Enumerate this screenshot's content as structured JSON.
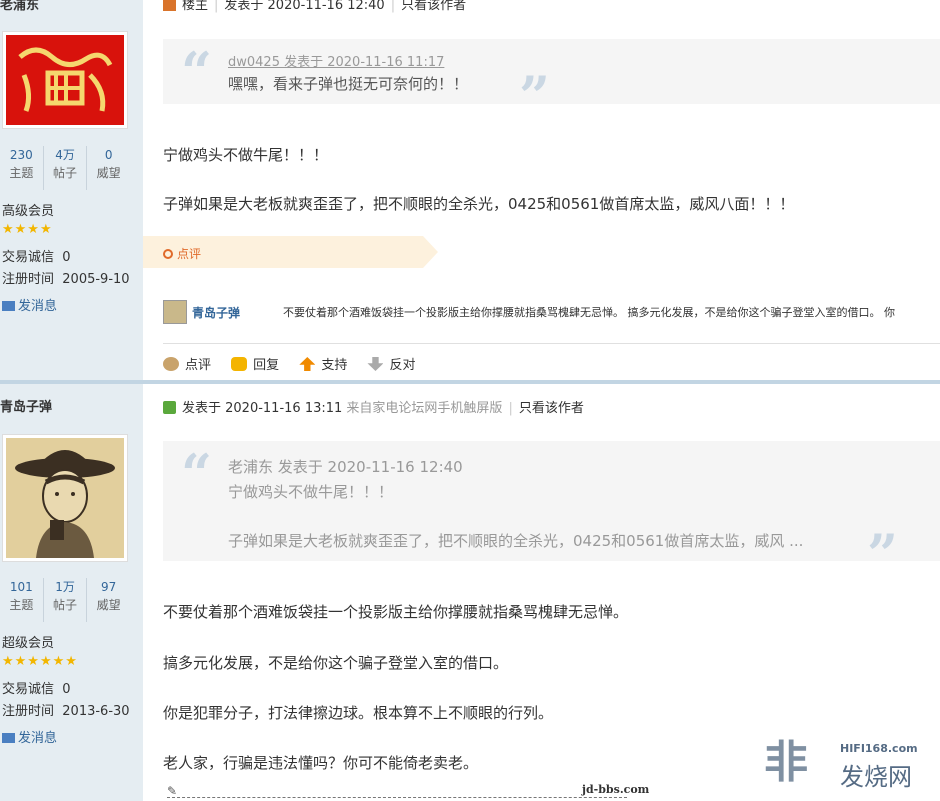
{
  "posts": [
    {
      "author": {
        "name": "老浦东",
        "stats": [
          {
            "value": "230",
            "label": "主题"
          },
          {
            "value": "4万",
            "label": "帖子"
          },
          {
            "value": "0",
            "label": "威望"
          }
        ],
        "rank": "高级会员",
        "stars": "★★★★",
        "trade_label": "交易诚信",
        "trade_value": "0",
        "reg_label": "注册时间",
        "reg_date": "2005-9-10",
        "message_link": "发消息"
      },
      "header": {
        "role": "楼主",
        "posted": "发表于 2020-11-16 12:40",
        "only_author": "只看该作者"
      },
      "quote": {
        "author": "dw0425 发表于 2020-11-16 11:17",
        "text": "嘿嘿，看来子弹也挺无可奈何的！！"
      },
      "body": [
        "宁做鸡头不做牛尾！！！",
        "子弹如果是大老板就爽歪歪了，把不顺眼的全杀光，0425和0561做首席太监，威风八面！！！"
      ],
      "comment_tab": "点评",
      "comment": {
        "user": "青岛子弹",
        "text": "不要仗着那个酒难饭袋挂一个投影版主给你撑腰就指桑骂槐肆无忌惮。  搞多元化发展，不是给你这个骗子登堂入室的借口。  你"
      },
      "actions": [
        "点评",
        "回复",
        "支持",
        "反对"
      ]
    },
    {
      "author": {
        "name": "青岛子弹",
        "stats": [
          {
            "value": "101",
            "label": "主题"
          },
          {
            "value": "1万",
            "label": "帖子"
          },
          {
            "value": "97",
            "label": "威望"
          }
        ],
        "rank": "超级会员",
        "stars": "★★★★★★",
        "trade_label": "交易诚信",
        "trade_value": "0",
        "reg_label": "注册时间",
        "reg_date": "2013-6-30",
        "message_link": "发消息"
      },
      "header": {
        "posted": "发表于 2020-11-16 13:11",
        "source": "来自家电论坛网手机触屏版",
        "only_author": "只看该作者"
      },
      "quote": {
        "author": "老浦东 发表于 2020-11-16 12:40",
        "line1": "宁做鸡头不做牛尾！！！",
        "line2": "子弹如果是大老板就爽歪歪了，把不顺眼的全杀光，0425和0561做首席太监，威风 ..."
      },
      "body": [
        "不要仗着那个酒难饭袋挂一个投影版主给你撑腰就指桑骂槐肆无忌惮。",
        "搞多元化发展，不是给你这个骗子登堂入室的借口。",
        "你是犯罪分子，打法律擦边球。根本算不上不顺眼的行列。",
        "老人家，行骗是违法懂吗？你可不能倚老卖老。"
      ],
      "signature": "jd-bbs.com"
    }
  ],
  "watermark": {
    "logo": "非",
    "site": "HIFI168.com",
    "name": "发烧网"
  },
  "colors": {
    "sidebar_bg": "#e5edf2",
    "link": "#336699",
    "star": "#f2b600",
    "comment_accent": "#e06a2a"
  }
}
